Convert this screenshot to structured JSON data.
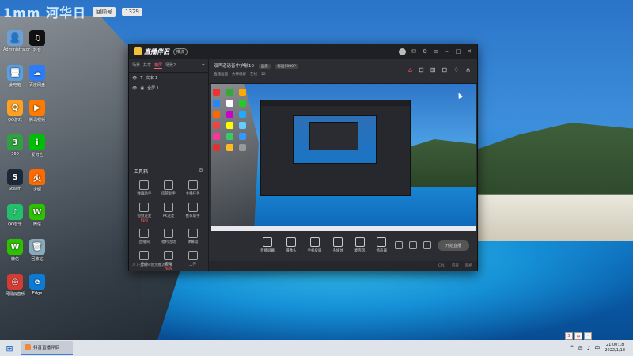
{
  "banner": {
    "logo_text": "1mm 河华日",
    "tag": "回顾号",
    "count": "1329"
  },
  "desktop_icons": [
    {
      "label": "Administrator",
      "glyph": "👤",
      "color": "#6aa0d8"
    },
    {
      "label": "此电脑",
      "glyph": "🖥",
      "color": "#5aa0e0"
    },
    {
      "label": "QQ游戏",
      "glyph": "Q",
      "color": "#ffa020"
    },
    {
      "label": "360",
      "glyph": "3",
      "color": "#30a040"
    },
    {
      "label": "Steam",
      "glyph": "S",
      "color": "#1b2838"
    },
    {
      "label": "QQ音乐",
      "glyph": "♪",
      "color": "#21c16b"
    },
    {
      "label": "微信",
      "glyph": "W",
      "color": "#2dc100"
    },
    {
      "label": "网易云音乐",
      "glyph": "◎",
      "color": "#d43c33"
    },
    {
      "label": "抖音",
      "glyph": "♫",
      "color": "#111"
    },
    {
      "label": "百度网盘",
      "glyph": "☁",
      "color": "#2a7cf7"
    },
    {
      "label": "腾讯视频",
      "glyph": "▶",
      "color": "#ff7a00"
    },
    {
      "label": "爱奇艺",
      "glyph": "i",
      "color": "#00be06"
    },
    {
      "label": "火绒",
      "glyph": "火",
      "color": "#ff6a00"
    },
    {
      "label": "微信",
      "glyph": "W",
      "color": "#2dc100"
    },
    {
      "label": "回收站",
      "glyph": "🗑",
      "color": "#8ab"
    },
    {
      "label": "Edge",
      "glyph": "e",
      "color": "#0a7cd6"
    }
  ],
  "window": {
    "app_name": "直播伴侣",
    "live_badge": "推流",
    "scene_tabs": [
      "场景",
      "共享",
      "横屏",
      "场景2"
    ],
    "active_scene": 2,
    "sources": [
      {
        "label": "文本 1"
      },
      {
        "label": "全屏 1"
      }
    ],
    "tools_title": "工具箱",
    "tools": [
      {
        "label": "弹幕助手",
        "new": ""
      },
      {
        "label": "房管助手",
        "new": ""
      },
      {
        "label": "主播任务",
        "new": ""
      },
      {
        "label": "视频连麦",
        "new": "NEW"
      },
      {
        "label": "PK连麦",
        "new": ""
      },
      {
        "label": "推荐助手",
        "new": ""
      },
      {
        "label": "直播间",
        "new": ""
      },
      {
        "label": "福利活动",
        "new": ""
      },
      {
        "label": "弹幕墙",
        "new": ""
      },
      {
        "label": "更多",
        "new": ""
      },
      {
        "label": "游戏",
        "new": "NEW"
      },
      {
        "label": "上传",
        "new": ""
      }
    ],
    "left_status": "⚠ 1-直播间暂无推流权限",
    "header": {
      "title": "双声道语音中护航10",
      "chip1": "画质",
      "chip2": "标准1080P",
      "sub_items": [
        "直播画面",
        "大师横屏",
        "在线",
        "12"
      ]
    },
    "controls": [
      {
        "label": "直播屏幕"
      },
      {
        "label": "摄像头"
      },
      {
        "label": "手机投屏"
      },
      {
        "label": "多媒体"
      },
      {
        "label": "麦克风"
      },
      {
        "label": "扬声器"
      }
    ],
    "go_live": "开始直播",
    "status_items": [
      "CPU",
      "内存",
      "网络"
    ]
  },
  "taskbar": {
    "app_label": "抖音直播伴侣",
    "time": "21:00:18",
    "date": "2022/1/18"
  }
}
